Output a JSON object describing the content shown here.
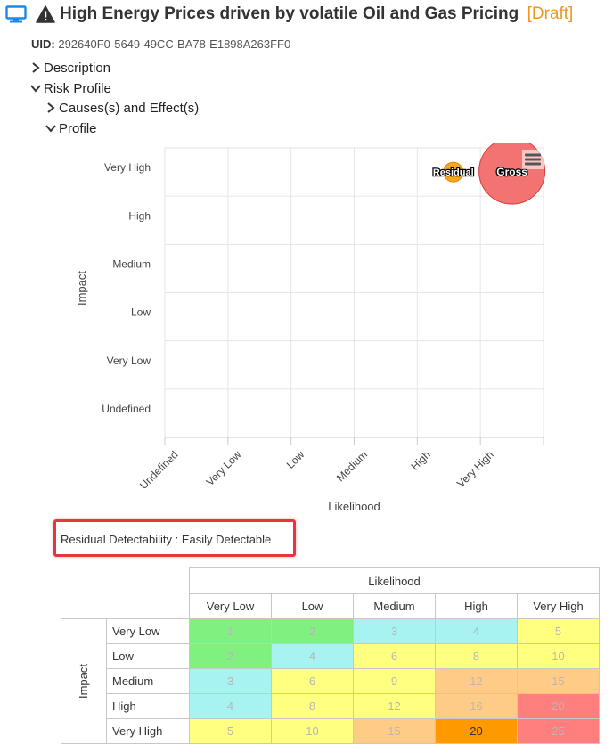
{
  "header": {
    "title": "High Energy Prices driven by volatile Oil and Gas Pricing",
    "status": "[Draft]",
    "uid_label": "UID:",
    "uid_value": "292640F0-5649-49CC-BA78-E1898A263FF0",
    "icons": [
      "monitor-icon",
      "warning-icon"
    ]
  },
  "tree": {
    "description": "Description",
    "risk_profile": "Risk Profile",
    "causes_effects": "Causes(s) and Effect(s)",
    "profile": "Profile"
  },
  "chart_data": {
    "type": "scatter",
    "xlabel": "Likelihood",
    "ylabel": "Impact",
    "x_categories": [
      "Undefined",
      "Very Low",
      "Low",
      "Medium",
      "High",
      "Very High"
    ],
    "y_categories": [
      "Undefined",
      "Very Low",
      "Low",
      "Medium",
      "High",
      "Very High"
    ],
    "series": [
      {
        "name": "Residual",
        "x": "High",
        "y": "Very High",
        "color": "#f5a623"
      },
      {
        "name": "Gross",
        "x": "Very High",
        "y": "Very High",
        "color": "#f26b6b"
      }
    ],
    "grid": true,
    "menu_icon": "hamburger-menu-icon"
  },
  "detectability": {
    "text": "Residual Detectability : Easily Detectable"
  },
  "matrix": {
    "likelihood_label": "Likelihood",
    "impact_label": "Impact",
    "columns": [
      "Very Low",
      "Low",
      "Medium",
      "High",
      "Very High"
    ],
    "rows": [
      {
        "label": "Very Low",
        "values": [
          "1",
          "2",
          "3",
          "4",
          "5"
        ]
      },
      {
        "label": "Low",
        "values": [
          "2",
          "4",
          "6",
          "8",
          "10"
        ]
      },
      {
        "label": "Medium",
        "values": [
          "3",
          "6",
          "9",
          "12",
          "15"
        ]
      },
      {
        "label": "High",
        "values": [
          "4",
          "8",
          "12",
          "16",
          "20"
        ]
      },
      {
        "label": "Very High",
        "values": [
          "5",
          "10",
          "15",
          "20",
          "25"
        ]
      }
    ],
    "colors": [
      [
        "#80f080",
        "#80f080",
        "#a6f3f2",
        "#a6f3f2",
        "#ffff80"
      ],
      [
        "#80f080",
        "#a6f3f2",
        "#ffff80",
        "#ffff80",
        "#ffff80"
      ],
      [
        "#a6f3f2",
        "#ffff80",
        "#ffff80",
        "#ffcc88",
        "#ffcc88"
      ],
      [
        "#a6f3f2",
        "#ffff80",
        "#ffff80",
        "#ffcc88",
        "#ff7f7f"
      ],
      [
        "#ffff80",
        "#ffff80",
        "#ffcc88",
        "#ff9900",
        "#ff7f7f"
      ]
    ],
    "highlighted": "20"
  }
}
